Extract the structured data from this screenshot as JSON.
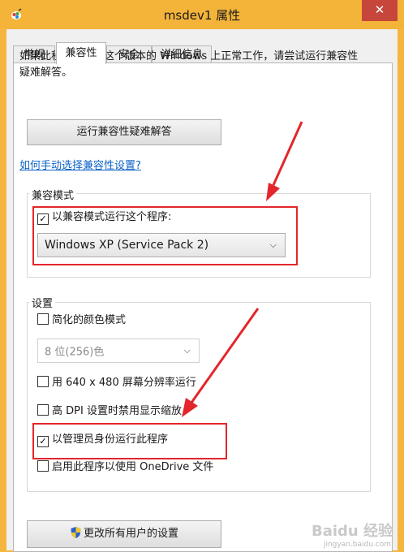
{
  "window": {
    "title": "msdev1 属性",
    "close_glyph": "✕"
  },
  "tabs": [
    {
      "label": "常规",
      "active": false
    },
    {
      "label": "兼容性",
      "active": true
    },
    {
      "label": "安全",
      "active": false
    },
    {
      "label": "详细信息",
      "active": false
    }
  ],
  "compat": {
    "intro": "如果此程序不能在这个版本的 Windows 上正常工作，请尝试运行兼容性疑难解答。",
    "troubleshoot_button": "运行兼容性疑难解答",
    "manual_link": "如何手动选择兼容性设置?",
    "mode_group": {
      "title": "兼容模式",
      "checkbox_label": "以兼容模式运行这个程序:",
      "checked": true,
      "selected_os": "Windows XP (Service Pack 2)"
    },
    "settings_group": {
      "title": "设置",
      "reduced_color": {
        "label": "简化的颜色模式",
        "checked": false
      },
      "color_select": "8 位(256)色",
      "res_640": {
        "label": "用 640 x 480 屏幕分辨率运行",
        "checked": false
      },
      "disable_dpi": {
        "label": "高 DPI 设置时禁用显示缩放",
        "checked": false
      },
      "run_as_admin": {
        "label": "以管理员身份运行此程序",
        "checked": true
      },
      "onedrive": {
        "label": "启用此程序以使用 OneDrive 文件",
        "checked": false
      }
    },
    "all_users_button": "更改所有用户的设置"
  },
  "watermark": {
    "text": "Baidu 经验",
    "url": "jingyan.baidu.com"
  },
  "colors": {
    "titlebar": "#f4b43a",
    "close": "#c7463b",
    "highlight": "#e3262b",
    "link": "#0b62c7"
  },
  "icons": [
    "app-icon",
    "close-icon",
    "checkbox-checked-icon",
    "chevron-down-icon",
    "uac-shield-icon",
    "red-arrow"
  ]
}
